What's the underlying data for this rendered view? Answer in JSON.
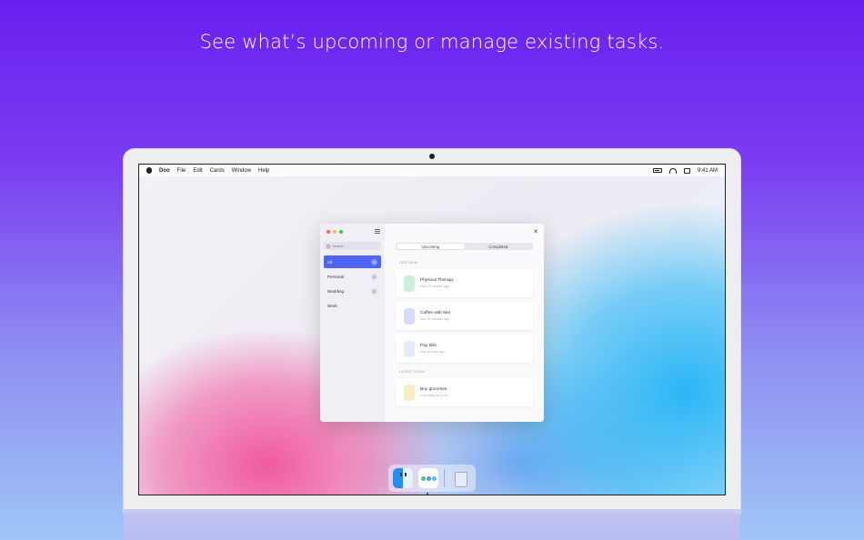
{
  "headline": "See what’s upcoming or manage existing tasks.",
  "menubar": {
    "app_name": "Doo",
    "items": [
      "File",
      "Edit",
      "Cards",
      "Window",
      "Help"
    ],
    "time": "9:41 AM"
  },
  "sidebar": {
    "search_placeholder": "Search",
    "items": [
      {
        "label": "All",
        "count": "3",
        "active": true
      },
      {
        "label": "Personal",
        "count": "2"
      },
      {
        "label": "Wedding",
        "count": "1"
      },
      {
        "label": "Work",
        "count": ""
      }
    ]
  },
  "main": {
    "tabs": [
      {
        "label": "Upcoming",
        "active": true
      },
      {
        "label": "Completed"
      }
    ],
    "section_due_now": "DUE NOW",
    "section_later_today": "LATER TODAY",
    "cards": [
      {
        "title": "Physical Therapy",
        "subtitle": "Due 25 minutes ago",
        "color": "#c9f0dc"
      },
      {
        "title": "Coffee with Mel",
        "subtitle": "Due 30 minutes ago",
        "color": "#d6dcfa"
      },
      {
        "title": "Pay bills",
        "subtitle": "Due an hour ago",
        "color": "#e2ecfb"
      },
      {
        "title": "Buy groceries",
        "subtitle": "Due today at 21:24",
        "color": "#f7efc4"
      }
    ]
  },
  "colors": {
    "accent": "#4f63f5",
    "background_top": "#6b1ff0",
    "background_bottom": "#9fc6f6"
  }
}
